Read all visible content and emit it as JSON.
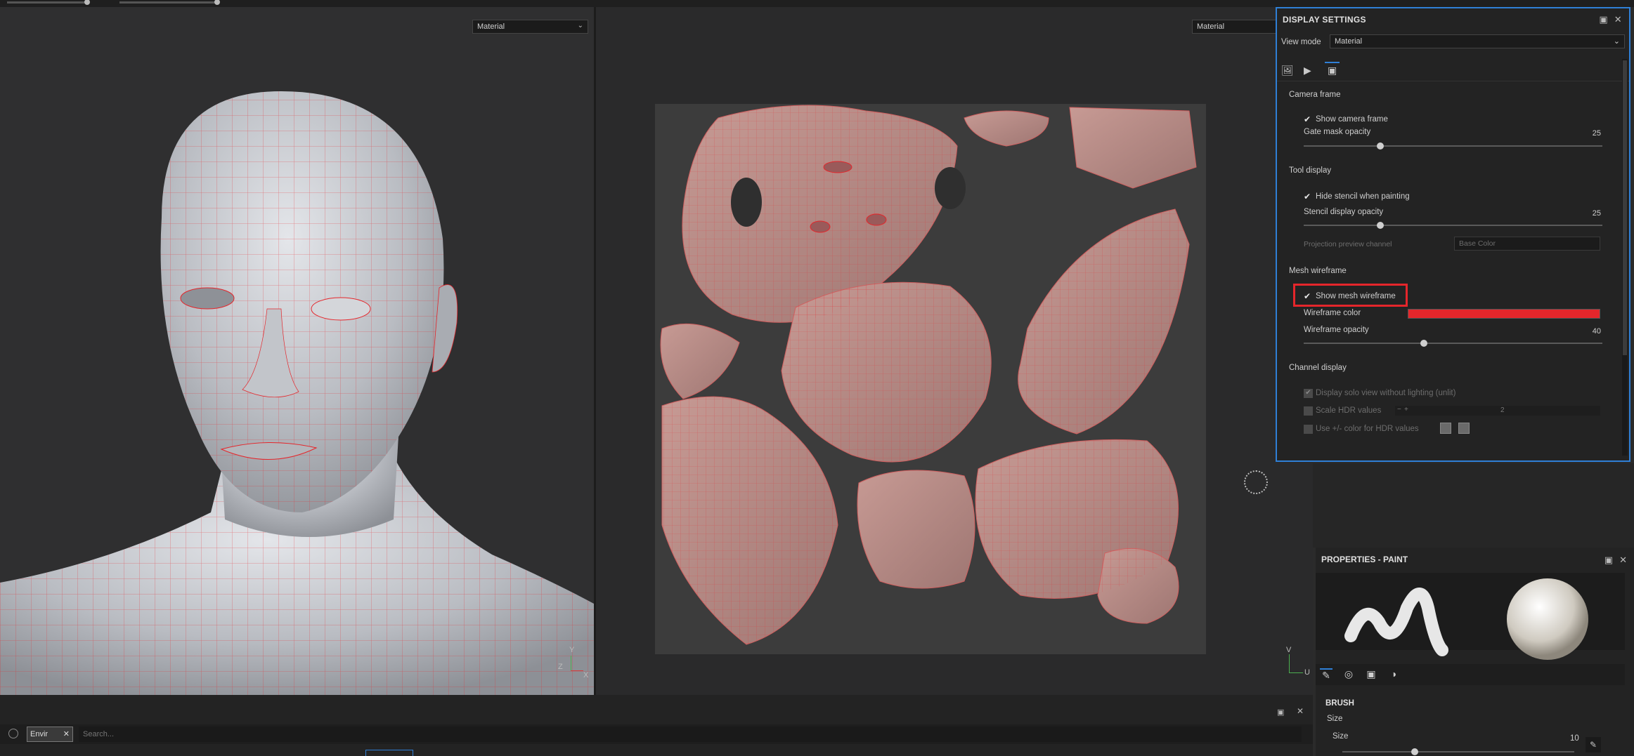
{
  "viewport_3d": {
    "mode": "Material",
    "axes": {
      "y": "Y",
      "z": "Z",
      "x": "X"
    }
  },
  "viewport_2d": {
    "mode": "Material",
    "axes": {
      "v": "V",
      "u": "U"
    }
  },
  "display_settings": {
    "title": "DISPLAY SETTINGS",
    "view_mode_label": "View mode",
    "view_mode_value": "Material",
    "camera_frame": {
      "title": "Camera frame",
      "show_camera_frame": "Show camera frame",
      "gate_mask_opacity_label": "Gate mask opacity",
      "gate_mask_opacity_value": "25",
      "gate_mask_opacity_fraction": 0.25
    },
    "tool_display": {
      "title": "Tool display",
      "hide_stencil": "Hide stencil when painting",
      "stencil_opacity_label": "Stencil display opacity",
      "stencil_opacity_value": "25",
      "stencil_opacity_fraction": 0.25,
      "projection_channel_label": "Projection preview channel",
      "projection_channel_value": "Base Color"
    },
    "mesh_wireframe": {
      "title": "Mesh wireframe",
      "show_mesh_wireframe": "Show mesh wireframe",
      "wireframe_color_label": "Wireframe color",
      "wireframe_color": "#e5262b",
      "wireframe_opacity_label": "Wireframe opacity",
      "wireframe_opacity_value": "40",
      "wireframe_opacity_fraction": 0.4
    },
    "channel_display": {
      "title": "Channel display",
      "solo_unlit": "Display solo view without lighting (unlit)",
      "scale_hdr": "Scale HDR values",
      "scale_hdr_value": "2",
      "use_color_hdr": "Use +/- color for HDR values"
    }
  },
  "properties_paint": {
    "title": "PROPERTIES - PAINT",
    "brush_section": "BRUSH",
    "size_group": "Size",
    "size_label": "Size",
    "size_value": "10"
  },
  "bottom": {
    "env_tab_label": "Envir",
    "search_placeholder": "Search..."
  },
  "colors": {
    "accent": "#2f7fd6",
    "highlight": "#e5262b",
    "wireframe": "#e5262b"
  }
}
